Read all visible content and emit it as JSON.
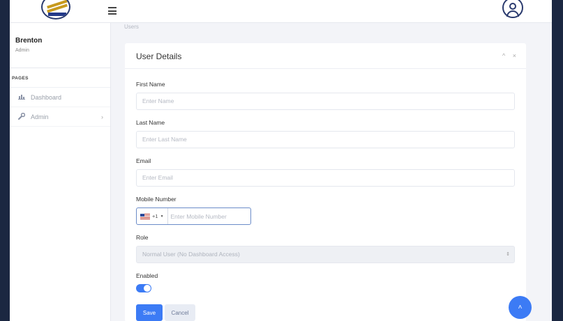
{
  "sidebar": {
    "user_name": "Brenton",
    "user_role": "Admin",
    "section_title": "PAGES",
    "items": [
      {
        "label": "Dashboard",
        "icon": "chart-icon"
      },
      {
        "label": "Admin",
        "icon": "wrench-icon"
      }
    ]
  },
  "breadcrumb": "Users",
  "card": {
    "title": "User Details",
    "tools": {
      "collapse": "^",
      "close": "×"
    }
  },
  "form": {
    "first_name": {
      "label": "First Name",
      "placeholder": "Enter Name"
    },
    "last_name": {
      "label": "Last Name",
      "placeholder": "Enter Last Name"
    },
    "email": {
      "label": "Email",
      "placeholder": "Enter Email"
    },
    "mobile": {
      "label": "Mobile Number",
      "dial_code": "+1",
      "placeholder": "Enter Mobile Number"
    },
    "role": {
      "label": "Role",
      "value": "Normal User (No Dashboard Access)"
    },
    "enabled": {
      "label": "Enabled",
      "value": true
    }
  },
  "actions": {
    "save": "Save",
    "cancel": "Cancel"
  },
  "colors": {
    "accent": "#3c7bf5",
    "navy": "#1b2741"
  }
}
